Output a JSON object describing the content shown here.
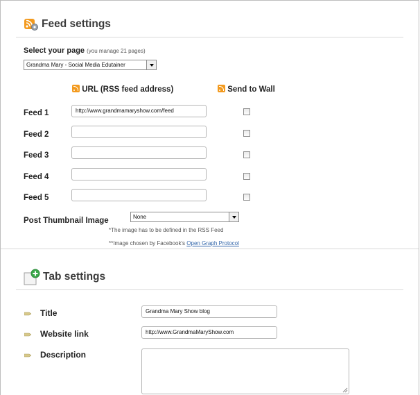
{
  "feed_settings": {
    "title": "Feed settings",
    "select_page_label": "Select your page",
    "manage_note": "(you manage 21 pages)",
    "page_select_value": "Grandma Mary - Social Media Edutainer",
    "url_header": "URL (RSS feed address)",
    "send_to_wall_header": "Send to Wall",
    "feeds": [
      {
        "label": "Feed 1",
        "value": "http://www.grandmamaryshow.com/feed",
        "checked": false
      },
      {
        "label": "Feed 2",
        "value": "",
        "checked": false
      },
      {
        "label": "Feed 3",
        "value": "",
        "checked": false
      },
      {
        "label": "Feed 4",
        "value": "",
        "checked": false
      },
      {
        "label": "Feed 5",
        "value": "",
        "checked": false
      }
    ],
    "thumbnail_label": "Post Thumbnail Image",
    "thumbnail_value": "None",
    "note_1": "*The image has to be defined in the RSS Feed",
    "note_2_prefix": "**Image chosen by Facebook's",
    "note_2_link": "Open Graph Protocol"
  },
  "tab_settings": {
    "title": "Tab settings",
    "fields": [
      {
        "label": "Title",
        "value": "Grandma Mary Show blog"
      },
      {
        "label": "Website link",
        "value": "http://www.GrandmaMaryShow.com"
      },
      {
        "label": "Description",
        "value": ""
      }
    ]
  },
  "colors": {
    "rss_orange": "#f39a1e",
    "link_blue": "#3366aa",
    "plus_green": "#3aa84a"
  },
  "icons": [
    "feed-settings-icon",
    "rss-icon",
    "tab-settings-icon",
    "pencil-bullet-icon"
  ]
}
